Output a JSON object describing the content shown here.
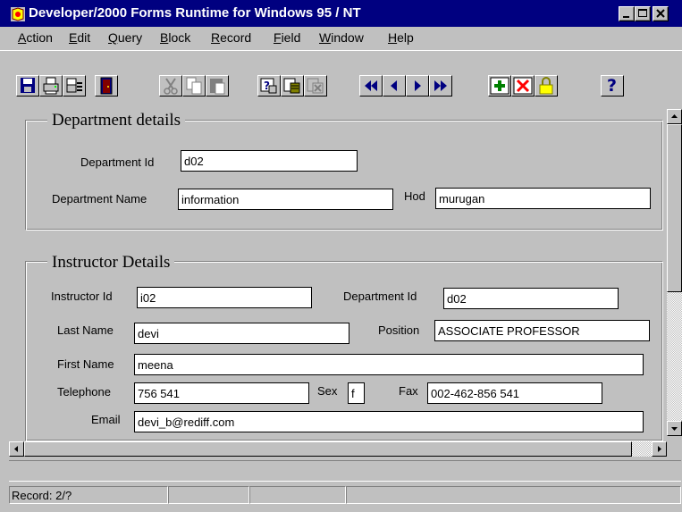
{
  "window": {
    "title": "Developer/2000 Forms Runtime for Windows 95 / NT"
  },
  "menu": [
    "Action",
    "Edit",
    "Query",
    "Block",
    "Record",
    "Field",
    "Window",
    "Help"
  ],
  "toolbar": {
    "buttons": [
      "save",
      "print",
      "print-setup",
      "exit",
      "cut",
      "copy",
      "paste",
      "enter-query",
      "execute-query",
      "cancel-query",
      "first-record",
      "previous-record",
      "next-record",
      "last-record",
      "insert-record",
      "delete-record",
      "lock-record",
      "help"
    ],
    "help_label": "?"
  },
  "department": {
    "title": "Department details",
    "id_label": "Department Id",
    "id_value": "d02",
    "name_label": "Department Name",
    "name_value": "information",
    "hod_label": "Hod",
    "hod_value": "murugan"
  },
  "instructor": {
    "title": "Instructor Details",
    "id_label": "Instructor Id",
    "id_value": "i02",
    "dept_label": "Department Id",
    "dept_value": "d02",
    "last_label": "Last Name",
    "last_value": "devi",
    "position_label": "Position",
    "position_value": "ASSOCIATE PROFESSOR",
    "first_label": "First Name",
    "first_value": "meena",
    "phone_label": "Telephone",
    "phone_value": "756 541",
    "sex_label": "Sex",
    "sex_value": "f",
    "fax_label": "Fax",
    "fax_value": "002-462-856 541",
    "email_label": "Email",
    "email_value": "devi_b@rediff.com"
  },
  "status": {
    "record": "Record: 2/?"
  },
  "colors": {
    "titlebar": "#000080",
    "face": "#c0c0c0"
  }
}
